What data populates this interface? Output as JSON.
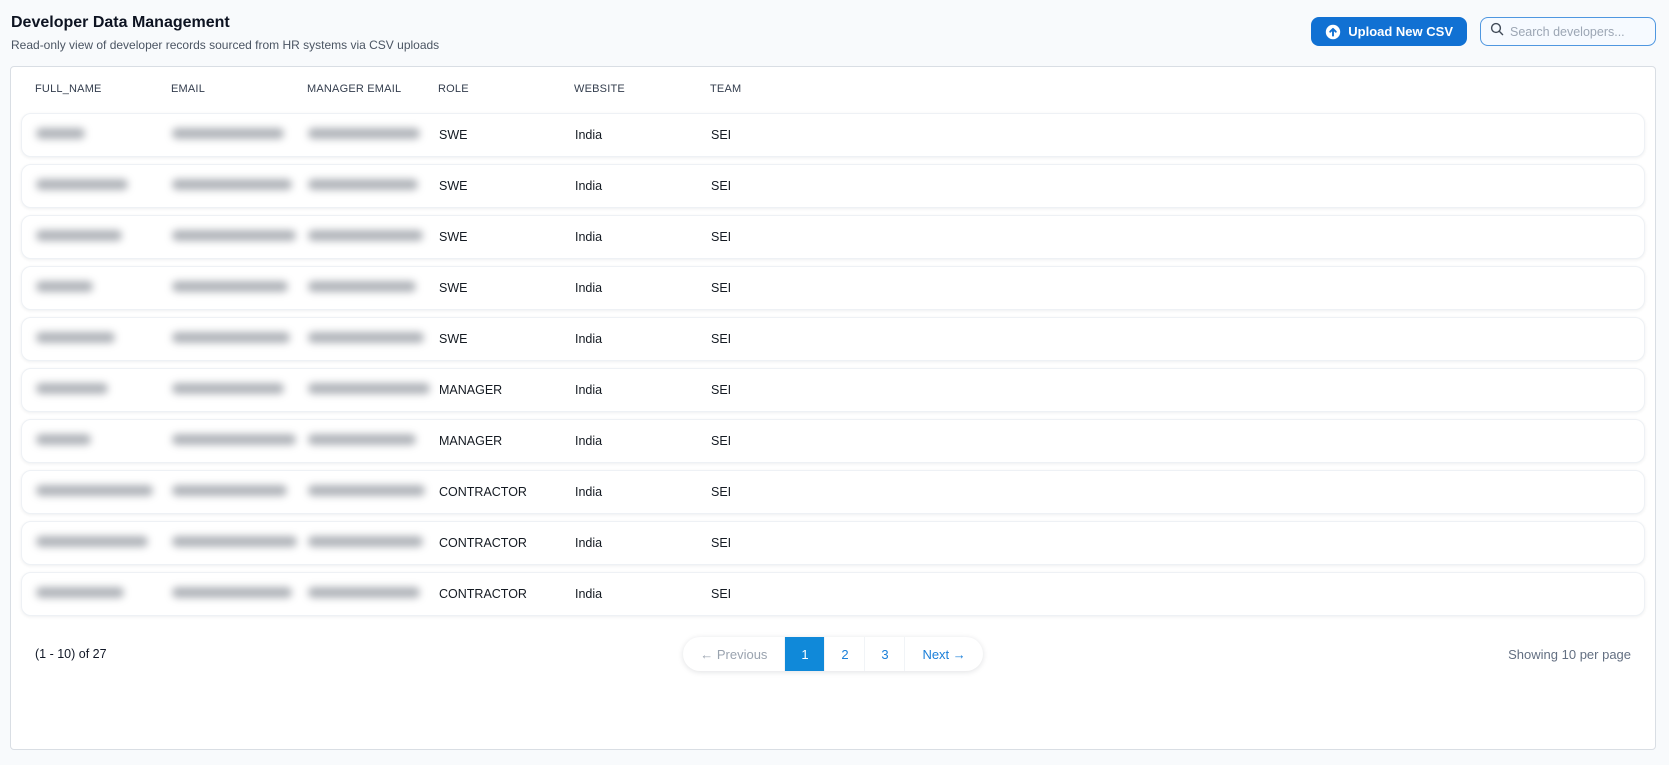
{
  "page": {
    "title": "Developer Data Management",
    "subtitle": "Read-only view of developer records sourced from HR systems via CSV uploads"
  },
  "toolbar": {
    "upload_button_label": "Upload New CSV",
    "search_placeholder": "Search developers...",
    "search_value": ""
  },
  "colors": {
    "primary_button": "#1171d3",
    "active_page": "#1089d9",
    "link_blue": "#1a7fd9",
    "page_background": "#f8fafc"
  },
  "table": {
    "columns": [
      "FULL_NAME",
      "EMAIL",
      "MANAGER EMAIL",
      "ROLE",
      "WEBSITE",
      "TEAM"
    ],
    "redacted_columns": [
      "FULL_NAME",
      "EMAIL",
      "MANAGER EMAIL"
    ],
    "rows": [
      {
        "full_name_redacted": true,
        "email_redacted": true,
        "manager_email_redacted": true,
        "role": "SWE",
        "website": "India",
        "team": "SEI",
        "blur": {
          "name": 49,
          "email": 112,
          "manager": 112
        }
      },
      {
        "full_name_redacted": true,
        "email_redacted": true,
        "manager_email_redacted": true,
        "role": "SWE",
        "website": "India",
        "team": "SEI",
        "blur": {
          "name": 92,
          "email": 120,
          "manager": 110
        }
      },
      {
        "full_name_redacted": true,
        "email_redacted": true,
        "manager_email_redacted": true,
        "role": "SWE",
        "website": "India",
        "team": "SEI",
        "blur": {
          "name": 86,
          "email": 124,
          "manager": 115
        }
      },
      {
        "full_name_redacted": true,
        "email_redacted": true,
        "manager_email_redacted": true,
        "role": "SWE",
        "website": "India",
        "team": "SEI",
        "blur": {
          "name": 57,
          "email": 116,
          "manager": 108
        }
      },
      {
        "full_name_redacted": true,
        "email_redacted": true,
        "manager_email_redacted": true,
        "role": "SWE",
        "website": "India",
        "team": "SEI",
        "blur": {
          "name": 79,
          "email": 118,
          "manager": 116
        }
      },
      {
        "full_name_redacted": true,
        "email_redacted": true,
        "manager_email_redacted": true,
        "role": "MANAGER",
        "website": "India",
        "team": "SEI",
        "blur": {
          "name": 72,
          "email": 112,
          "manager": 122
        }
      },
      {
        "full_name_redacted": true,
        "email_redacted": true,
        "manager_email_redacted": true,
        "role": "MANAGER",
        "website": "India",
        "team": "SEI",
        "blur": {
          "name": 55,
          "email": 124,
          "manager": 108
        }
      },
      {
        "full_name_redacted": true,
        "email_redacted": true,
        "manager_email_redacted": true,
        "role": "CONTRACTOR",
        "website": "India",
        "team": "SEI",
        "blur": {
          "name": 117,
          "email": 115,
          "manager": 117
        }
      },
      {
        "full_name_redacted": true,
        "email_redacted": true,
        "manager_email_redacted": true,
        "role": "CONTRACTOR",
        "website": "India",
        "team": "SEI",
        "blur": {
          "name": 112,
          "email": 125,
          "manager": 115
        }
      },
      {
        "full_name_redacted": true,
        "email_redacted": true,
        "manager_email_redacted": true,
        "role": "CONTRACTOR",
        "website": "India",
        "team": "SEI",
        "blur": {
          "name": 88,
          "email": 120,
          "manager": 112
        }
      }
    ]
  },
  "footer": {
    "range_label": "(1 - 10) of 27",
    "per_page_label": "Showing 10 per page",
    "pagination": {
      "previous_label": "← Previous",
      "pages": [
        "1",
        "2",
        "3"
      ],
      "active_page": "1",
      "next_label": "Next →"
    }
  }
}
